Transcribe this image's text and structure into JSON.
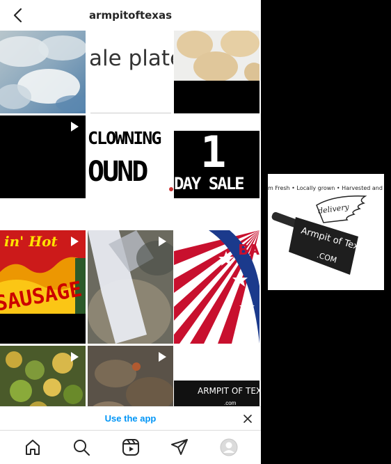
{
  "header": {
    "title": "armpitoftexas"
  },
  "grid": {
    "cell_texts": {
      "plate": "ale plate",
      "clowning_top": "CLOWNING",
      "clowning_bottom": "OUND",
      "sale_number": "1",
      "sale_text": "DAY SALE",
      "sausage_top": "in' Hot",
      "sausage_bottom": "SAUSAGE",
      "bbq": "BA",
      "logo_text": "ARMPIT OF TEXAS",
      "logo_com": ".com"
    }
  },
  "banner": {
    "label": "Use the app"
  },
  "side_logo": {
    "tagline": "m Fresh  •  Locally grown  •  Harvested and Delivere",
    "delivery": "delivery",
    "brand": "Armpit of Texas",
    "com": ".COM"
  },
  "icons": {
    "back": "back-chevron-icon",
    "play": "play-icon",
    "close": "close-icon",
    "home": "home-icon",
    "search": "search-icon",
    "reels": "reels-icon",
    "direct": "paper-plane-icon",
    "profile": "avatar-icon"
  }
}
